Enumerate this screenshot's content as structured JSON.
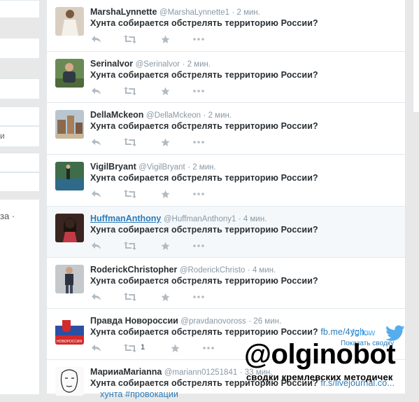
{
  "left_sidebar": {
    "snippet_1": "и",
    "snippet_2": "за ·"
  },
  "tweets": [
    {
      "name": "MarshaLynnette",
      "handle": "@MarshaLynnette1",
      "time": "· 2 мин.",
      "text": "Хунта собирается обстрелять территорию России?",
      "avatar": "woman-white-dress"
    },
    {
      "name": "Serinalvor",
      "handle": "@Serinalvor",
      "time": "· 2 мин.",
      "text": "Хунта собирается обстрелять территорию России?",
      "avatar": "man-outdoors"
    },
    {
      "name": "DellaMckeon",
      "handle": "@DellaMckeon",
      "time": "· 2 мин.",
      "text": "Хунта собирается обстрелять территорию России?",
      "avatar": "buildings"
    },
    {
      "name": "VigilBryant",
      "handle": "@VigilBryant",
      "time": "· 2 мин.",
      "text": "Хунта собирается обстрелять территорию России?",
      "avatar": "tennis-court"
    },
    {
      "name": "HuffmanAnthony",
      "handle": "@HuffmanAnthony1",
      "time": "· 4 мин.",
      "text": "Хунта собирается обстрелять территорию России?",
      "avatar": "woman-dark-hair"
    },
    {
      "name": "RoderickChristopher",
      "handle": "@RoderickChristo",
      "time": "· 4 мин.",
      "text": "Хунта собирается обстрелять территорию России?",
      "avatar": "man-standing"
    },
    {
      "name": "Правда Новороссии",
      "handle": "@pravdanovoross",
      "time": "· 26 мин.",
      "text": "Хунта собирается обстрелять территорию России?",
      "link": "fb.me/4ygh...",
      "retweet_count": "1",
      "avatar": "novorossia-flag"
    },
    {
      "name": "МарииаMarianna",
      "handle": "@mariann01251841",
      "time": "· 33 мин.",
      "text": "Хунта собирается обстрелять территорию России?",
      "link": "fr.s/livejournal.co...",
      "extra": "хунта #провокации",
      "avatar": "sketch-face"
    }
  ],
  "tweet_actions": [
    "reply-icon",
    "retweet-icon",
    "favorite-icon",
    "more-icon"
  ],
  "overlay": {
    "follow": "follow",
    "show_summary": "Показать сводку",
    "watermark_big": "@olginobot",
    "watermark_sub": "сводки кремлевских методичек"
  },
  "colors": {
    "link": "#2b7bb9",
    "muted": "#8899a6",
    "action": "#b1bbc3",
    "twitter_blue": "#55acee"
  }
}
